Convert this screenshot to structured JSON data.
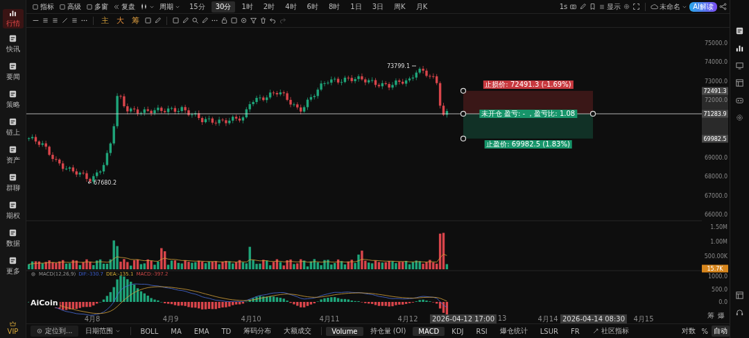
{
  "sidebar": {
    "items": [
      {
        "label": "行情",
        "selected": true
      },
      {
        "label": "快讯",
        "selected": false
      },
      {
        "label": "要闻",
        "selected": false
      },
      {
        "label": "策略",
        "selected": false
      },
      {
        "label": "链上",
        "selected": false
      },
      {
        "label": "资产",
        "selected": false
      },
      {
        "label": "群聊",
        "selected": false
      },
      {
        "label": "期权",
        "selected": false
      },
      {
        "label": "数据",
        "selected": false
      },
      {
        "label": "更多",
        "selected": false
      }
    ],
    "vip": "VIP"
  },
  "toolbar": {
    "tools": [
      "指标",
      "高级",
      "多窗",
      "复盘"
    ],
    "period_label": "周期",
    "intervals": [
      {
        "label": "15分",
        "selected": false
      },
      {
        "label": "30分",
        "selected": true
      },
      {
        "label": "1时",
        "selected": false
      },
      {
        "label": "2时",
        "selected": false
      },
      {
        "label": "4时",
        "selected": false
      },
      {
        "label": "6时",
        "selected": false
      },
      {
        "label": "8时",
        "selected": false
      },
      {
        "label": "1日",
        "selected": false
      },
      {
        "label": "3日",
        "selected": false
      },
      {
        "label": "周K",
        "selected": false
      },
      {
        "label": "月K",
        "selected": false
      }
    ],
    "refresh": "1s",
    "display": "显示",
    "layout_name": "未命名",
    "ai_button": "AI解读"
  },
  "drawing_toolbar": {
    "shortcuts": [
      "主",
      "大",
      "筹"
    ]
  },
  "chart": {
    "high_label": "73799.1",
    "low_label": "67680.2",
    "logo": "AiCoin",
    "price_ticks": [
      "75000.0",
      "74000.0",
      "73000.0",
      "72000.0",
      "69000.0",
      "68000.0",
      "67000.0",
      "66000.0"
    ],
    "price_marks": [
      {
        "value": "72491.3",
        "kind": "stop"
      },
      {
        "value": "71283.9",
        "kind": "entry"
      },
      {
        "value": "69982.5",
        "kind": "target"
      }
    ],
    "position": {
      "stop_loss": "止损价: 72491.3 (-1.69%)",
      "status": "未开仓  盈亏: - ，盈亏比: 1.08",
      "take_profit": "止盈价: 69982.5 (1.83%)"
    },
    "volume_ticks": [
      "1.50M",
      "1.00M",
      "500.00K"
    ],
    "volume_mark": "15.7K",
    "macd_legend": {
      "title": "MACD(12,26,9)",
      "dif": "DIF:-330.7",
      "dea": "DEA:-135.1",
      "macd": "MACD:-397.2"
    },
    "macd_ticks": [
      "1000.0",
      "500.0",
      "0.0"
    ],
    "x_labels": [
      {
        "text": "4月8",
        "kind": "date"
      },
      {
        "text": "4月9",
        "kind": "date"
      },
      {
        "text": "4月10",
        "kind": "date"
      },
      {
        "text": "4月11",
        "kind": "date"
      },
      {
        "text": "4月12",
        "kind": "date"
      },
      {
        "text": "2026-04-12 17:00",
        "kind": "cursor"
      },
      {
        "text": "13",
        "kind": "date"
      },
      {
        "text": "4月14",
        "kind": "date"
      },
      {
        "text": "2026-04-14 08:30",
        "kind": "cursor"
      },
      {
        "text": "4月15",
        "kind": "date"
      }
    ],
    "axis_toggles": [
      "筹",
      "爆"
    ]
  },
  "bottom_bar": {
    "locate": "定位到...",
    "date_range": "日期范围",
    "main_indicators": [
      "BOLL",
      "MA",
      "EMA",
      "TD",
      "筹码分布",
      "大额成交"
    ],
    "sub_indicators": [
      {
        "label": "Volume",
        "selected": true
      },
      {
        "label": "持仓量 (OI)",
        "selected": false
      },
      {
        "label": "MACD",
        "selected": true
      },
      {
        "label": "KDJ",
        "selected": false
      },
      {
        "label": "RSI",
        "selected": false
      },
      {
        "label": "爆仓统计",
        "selected": false
      },
      {
        "label": "LSUR",
        "selected": false
      },
      {
        "label": "FR",
        "selected": false
      }
    ],
    "community": "社区指标",
    "scale_modes": [
      {
        "label": "对数",
        "selected": false
      },
      {
        "label": "%",
        "selected": false
      },
      {
        "label": "自动",
        "selected": true
      }
    ]
  }
}
